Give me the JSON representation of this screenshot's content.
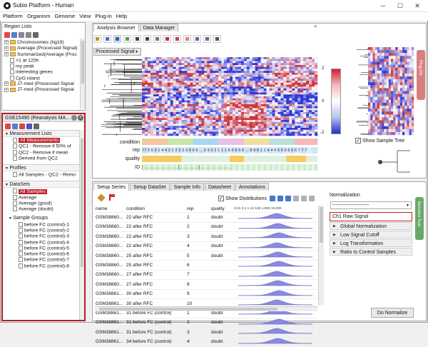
{
  "window": {
    "title": "Subio Platform - Human",
    "minimize": "─",
    "maximize": "☐",
    "close": "✕"
  },
  "menu": [
    "Platform",
    "Organism",
    "Genome",
    "View",
    "Plug-in",
    "Help"
  ],
  "region_lists": {
    "title": "Region Lists",
    "items": [
      {
        "label": "Chromosomes (hg19)",
        "icon": "folder",
        "expand": "+"
      },
      {
        "label": "Average (Processed Signal)",
        "icon": "folder",
        "expand": "+"
      },
      {
        "label": "Summarized(Average (Proc",
        "icon": "folder",
        "expand": "+"
      },
      {
        "label": ">1 at 120h",
        "icon": "doc"
      },
      {
        "label": "my peak",
        "icon": "doc"
      },
      {
        "label": "interesting genes",
        "icon": "doc"
      },
      {
        "label": "CpG island",
        "icon": "doc"
      },
      {
        "label": "J7-med (Processed Signal",
        "icon": "folder",
        "expand": "+"
      },
      {
        "label": "J7-med (Processed Signal",
        "icon": "folder",
        "expand": "+"
      }
    ]
  },
  "series_panel": {
    "title": "GSE15490 (Reanalysis MA...",
    "sections": [
      {
        "label": "Measurement Lists",
        "items": [
          "All Measurements",
          "QC1 - Remove if 50% of",
          "QC2 - Remove if mean",
          "Derived from QC2"
        ]
      },
      {
        "label": "Profiles",
        "items": [
          "All Samples - QC2 - Remo"
        ]
      },
      {
        "label": "DataSets",
        "items": [
          "All Samples",
          "Average",
          "Average (good)",
          "Average (doubt)"
        ]
      },
      {
        "label": "Sample Groups",
        "items": [
          "before FC (control)-1",
          "before FC (control)-2",
          "before FC (control)-3",
          "before FC (control)-4",
          "before FC (control)-5",
          "before FC (control)-6",
          "before FC (control)-7",
          "before FC (control)-8"
        ]
      }
    ]
  },
  "analysis_tabs": [
    "Analysis Browser",
    "Data Manager"
  ],
  "dropdown": {
    "value": "Processed Signal",
    "arrow": "▼"
  },
  "heatmap": {
    "scale_max": "2",
    "scale_zero": "0",
    "scale_min": "-2",
    "track_labels": [
      "condition",
      "rep",
      "quality",
      "ID"
    ],
    "rep_numbers": "77 5 5 3 1 4 4 2 2 2 3 3 3 9 9 9 ... 9 9 2 2 1 1 1 6 6 8 8 8 ... 8 8 8 1 1 4 4 4 5 5 5 6 6 6 7 7 7",
    "id_text": "[..................]..........[.................",
    "legend_label": "Show Sample Tree",
    "side_tab": "Plug-ins"
  },
  "setup_tabs": [
    "Setup Series",
    "Setup DataSet",
    "Sample Info",
    "Datasheet",
    "Annotations"
  ],
  "show_distributions": "Show Distributions",
  "dist_axis": "0.01  0.1   1   10   100  1,000  10,000",
  "table": {
    "headers": [
      "name",
      "condition",
      "rep",
      "quality"
    ],
    "rows": [
      [
        "GSM38860...",
        "22 after RFC",
        "1",
        "doubt"
      ],
      [
        "GSM38860...",
        "22 after RFC",
        "2",
        "doubt"
      ],
      [
        "GSM38860...",
        "22 after RFC",
        "3",
        "doubt"
      ],
      [
        "GSM38860...",
        "22 after RFC",
        "4",
        "doubt"
      ],
      [
        "GSM38860...",
        "25 after RFC",
        "5",
        "doubt"
      ],
      [
        "GSM38860...",
        "25 after RFC",
        "6",
        ""
      ],
      [
        "GSM38860...",
        "27 after RFC",
        "7",
        ""
      ],
      [
        "GSM38860...",
        "27 after RFC",
        "8",
        ""
      ],
      [
        "GSM38861...",
        "30 after RFC",
        "9",
        ""
      ],
      [
        "GSM38861...",
        "30 after RFC",
        "10",
        ""
      ],
      [
        "GSM38861...",
        "31 before FC (control)",
        "1",
        "doubt"
      ],
      [
        "GSM38861...",
        "31 before FC (control)",
        "2",
        "doubt"
      ],
      [
        "GSM38861...",
        "31 before FC (control)",
        "3",
        "doubt"
      ],
      [
        "GSM38861...",
        "34 before FC (control)",
        "4",
        "doubt"
      ]
    ]
  },
  "normalization": {
    "title": "Normalization",
    "select": "----------------------",
    "steps": [
      "Ch1 Raw Signal",
      "Global Normalization",
      "Low Signal Cutoff",
      "Log Transformation",
      "Ratio to Control Samples"
    ],
    "button": "Do Normalize",
    "side_tab": "Normalize Tools"
  }
}
